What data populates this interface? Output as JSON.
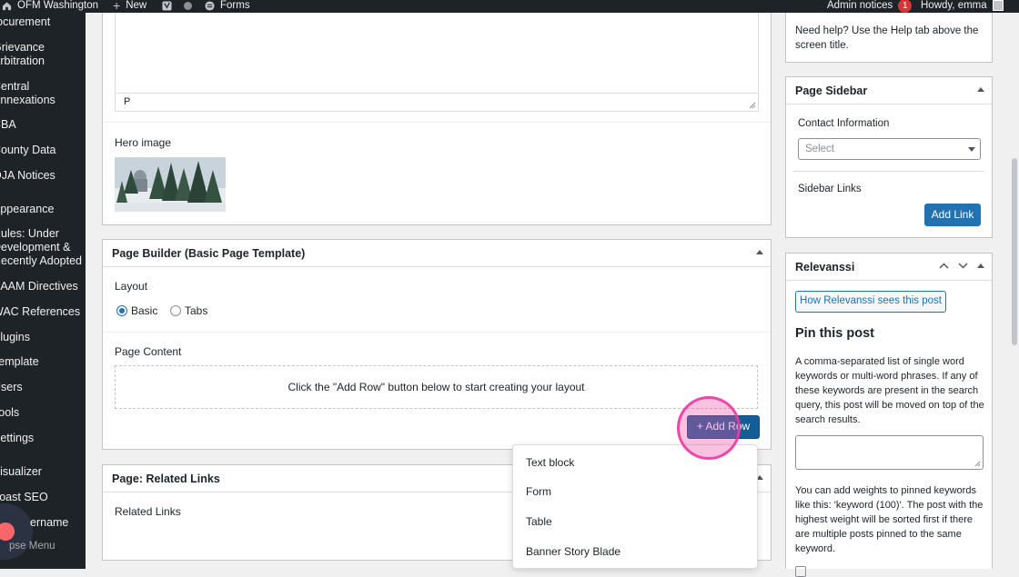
{
  "adminbar": {
    "site_name": "OFM Washington",
    "new_label": "New",
    "forms_label": "Forms",
    "admin_notices": "Admin notices",
    "notices_count": "1",
    "howdy": "Howdy, emma"
  },
  "sidebar": {
    "items": [
      "rocurement",
      "Grievance",
      "Arbitration",
      "Central",
      "Annexations",
      "CBA",
      "County Data",
      "OJA Notices",
      "Appearance",
      "Rules: Under",
      "Development &",
      "Recently Adopted",
      "SAAM Directives",
      "WAC References",
      "Plugins",
      "Template",
      "Users",
      "Tools",
      "Settings",
      "Visualizer",
      "Yoast SEO",
      "ername"
    ],
    "collapse": "pse Menu"
  },
  "editor": {
    "path_label": "P",
    "hero_label": "Hero image"
  },
  "page_builder": {
    "title": "Page Builder (Basic Page Template)",
    "layout_label": "Layout",
    "layout_options": [
      "Basic",
      "Tabs"
    ],
    "content_label": "Page Content",
    "empty_text": "Click the \"Add Row\" button below to start creating your layout",
    "add_row": "+ Add Row"
  },
  "related_links": {
    "title": "Page: Related Links",
    "field_label": "Related Links"
  },
  "add_row_menu": {
    "items": [
      "Text block",
      "Form",
      "Table",
      "Banner Story Blade"
    ]
  },
  "help_box": {
    "text": "Need help? Use the Help tab above the screen title."
  },
  "page_sidebar": {
    "title": "Page Sidebar",
    "contact_label": "Contact Information",
    "select_placeholder": "Select",
    "links_label": "Sidebar Links",
    "add_link": "Add Link"
  },
  "relevanssi": {
    "title": "Relevanssi",
    "how_button": "How Relevanssi sees this post",
    "pin_heading": "Pin this post",
    "pin_description": "A comma-separated list of single word keywords or multi-word phrases. If any of these keywords are present in the search query, this post will be moved on top of the search results.",
    "weights_note": "You can add weights to pinned keywords like this: 'keyword (100)'. The post with the highest weight will be sorted first if there are multiple posts pinned to the same keyword."
  }
}
